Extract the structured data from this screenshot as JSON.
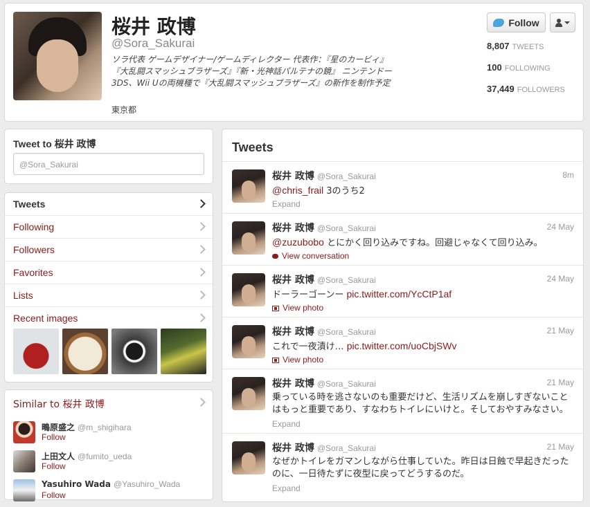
{
  "profile": {
    "name": "桜井 政博",
    "handle": "@Sora_Sakurai",
    "bio": "ソラ代表 ゲームデザイナー/ゲームディレクター 代表作：『星のカービィ』『大乱闘スマッシュブラザーズ』『新・光神話パルテナの鏡』 ニンテンドー3DS、Wii Uの両機種で『大乱闘スマッシュブラザーズ』の新作を制作予定",
    "location": "東京都",
    "follow_label": "Follow",
    "stats": [
      {
        "value": "8,807",
        "label": "TWEETS"
      },
      {
        "value": "100",
        "label": "FOLLOWING"
      },
      {
        "value": "37,449",
        "label": "FOLLOWERS"
      }
    ]
  },
  "tweet_to": {
    "title": "Tweet to 桜井 政博",
    "placeholder": "@Sora_Sakurai"
  },
  "nav": {
    "items": [
      {
        "label": "Tweets"
      },
      {
        "label": "Following"
      },
      {
        "label": "Followers"
      },
      {
        "label": "Favorites"
      },
      {
        "label": "Lists"
      },
      {
        "label": "Recent images"
      }
    ]
  },
  "similar": {
    "title": "Similar to 桜井 政博",
    "users": [
      {
        "name": "鴫原盛之",
        "handle": "@m_shigihara",
        "follow": "Follow"
      },
      {
        "name": "上田文人",
        "handle": "@fumito_ueda",
        "follow": "Follow"
      },
      {
        "name": "Yasuhiro Wada",
        "handle": "@Yasuhiro_Wada",
        "follow": "Follow"
      }
    ]
  },
  "tweets": {
    "header": "Tweets",
    "items": [
      {
        "name": "桜井 政博",
        "handle": "@Sora_Sakurai",
        "time": "8m",
        "mention": "@chris_frail",
        "text": " 3のうち2",
        "action": "Expand"
      },
      {
        "name": "桜井 政博",
        "handle": "@Sora_Sakurai",
        "time": "24 May",
        "mention": "@zuzubobo",
        "text": " とにかく回り込みですね。回避じゃなくて回り込み。",
        "action": "View conversation"
      },
      {
        "name": "桜井 政博",
        "handle": "@Sora_Sakurai",
        "time": "24 May",
        "text": "ドーラーゴーンー ",
        "link": "pic.twitter.com/YcCtP1af",
        "action": "View photo"
      },
      {
        "name": "桜井 政博",
        "handle": "@Sora_Sakurai",
        "time": "21 May",
        "text": "これで一夜漬け… ",
        "link": "pic.twitter.com/uoCbjSWv",
        "action": "View photo"
      },
      {
        "name": "桜井 政博",
        "handle": "@Sora_Sakurai",
        "time": "21 May",
        "text": "乗っている時を逃さないのも重要だけど、生活リズムを崩しすぎないことはもっと重要であり、すなわちトイレにいけと。そしておやすみなさい。",
        "action": "Expand"
      },
      {
        "name": "桜井 政博",
        "handle": "@Sora_Sakurai",
        "time": "21 May",
        "text": "なぜかトイレをガマンしながら仕事していた。昨日は日蝕で早起きだったのに、一日待たずに夜型に戻ってどうするのだ。",
        "action": "Expand"
      }
    ]
  }
}
